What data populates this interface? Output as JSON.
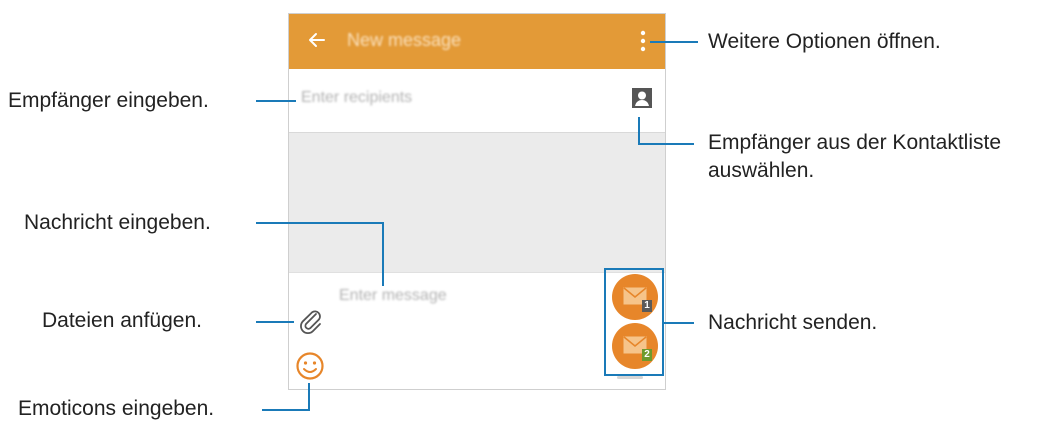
{
  "appbar": {
    "title": "New message",
    "back_icon": "arrow-left-icon",
    "more_icon": "more-vertical-icon",
    "color": "#e39a37"
  },
  "recipients": {
    "placeholder": "Enter recipients",
    "contacts_icon": "contact-icon"
  },
  "compose": {
    "placeholder": "Enter message",
    "attach_icon": "paperclip-icon",
    "emoticon_icon": "smiley-icon",
    "send_buttons": [
      {
        "icon": "envelope-icon",
        "sim": "1"
      },
      {
        "icon": "envelope-icon",
        "sim": "2"
      }
    ]
  },
  "callouts": {
    "more_options": "Weitere Optionen öffnen.",
    "enter_recipients": "Empfänger eingeben.",
    "contacts_line1": "Empfänger aus der Kontaktliste",
    "contacts_line2": "auswählen.",
    "enter_message": "Nachricht eingeben.",
    "attach_files": "Dateien anfügen.",
    "send_message": "Nachricht senden.",
    "enter_emoticons": "Emoticons eingeben."
  },
  "colors": {
    "accent": "#e39a37",
    "send": "#e7862a",
    "callout_line": "#1a7ab8"
  }
}
